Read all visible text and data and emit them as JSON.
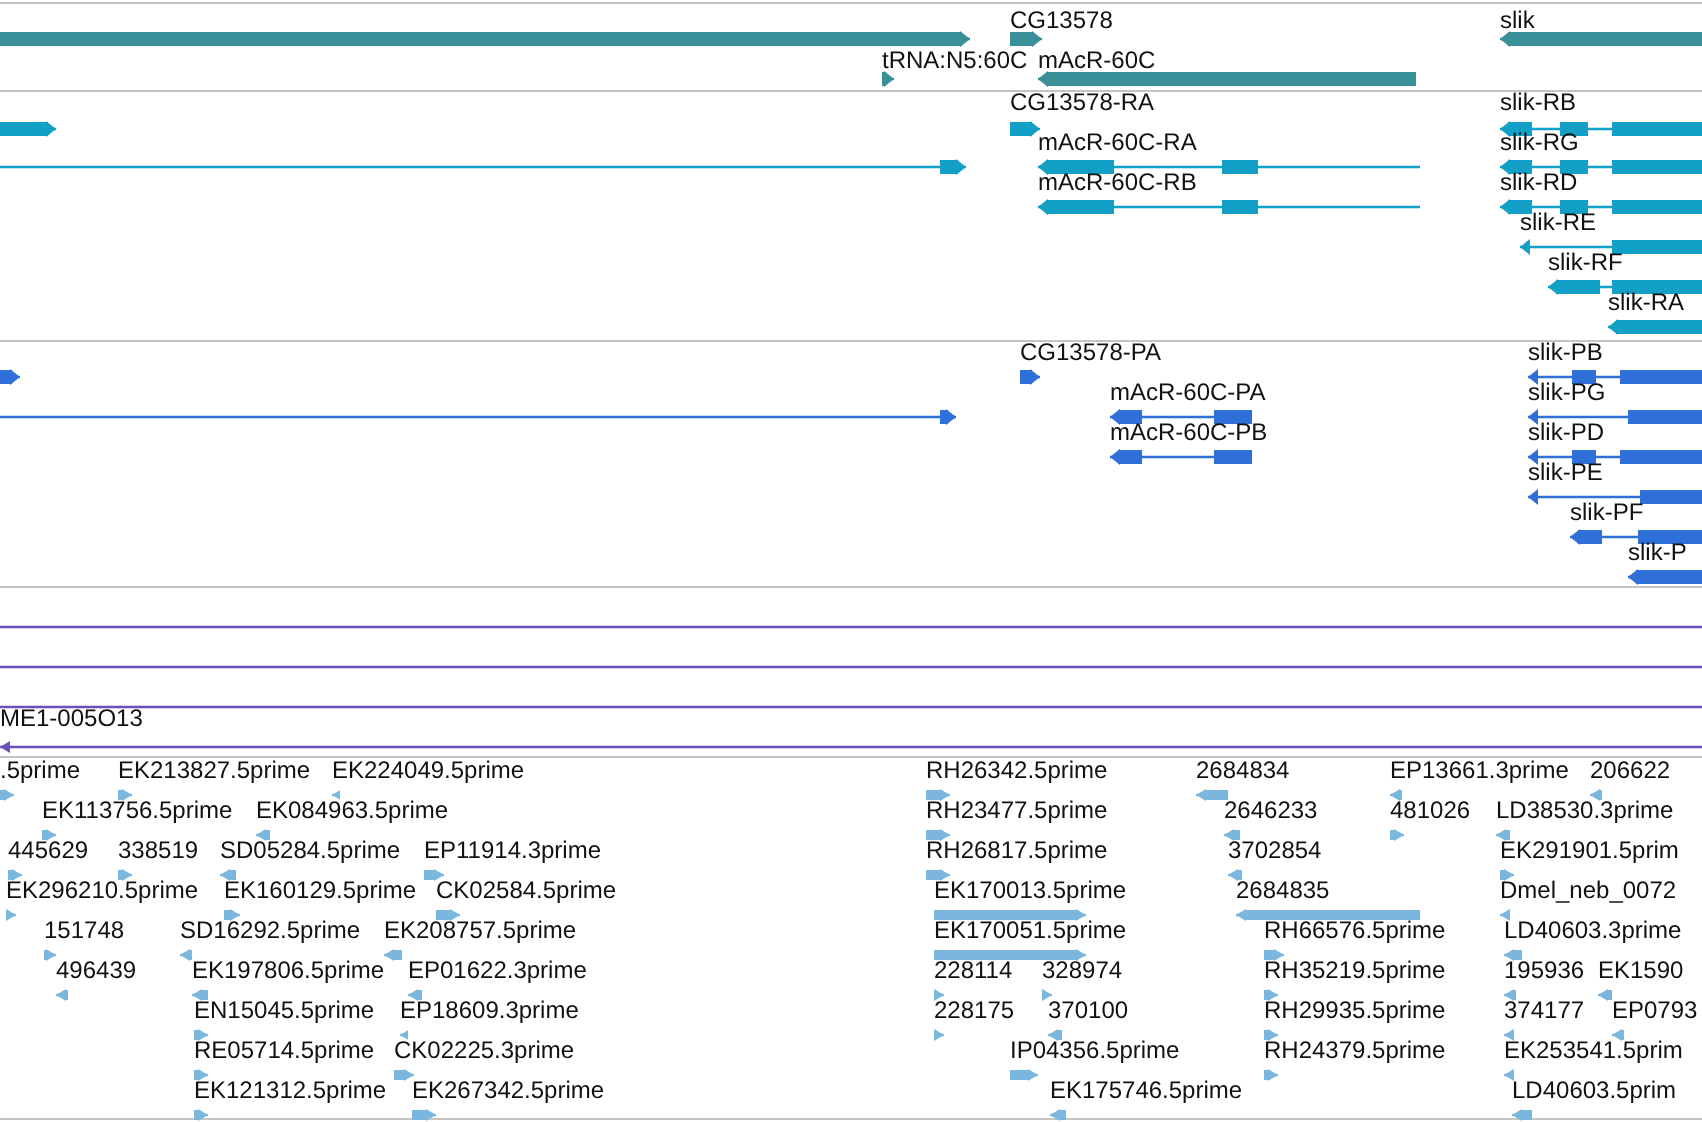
{
  "tracks": [
    {
      "kind": "gene",
      "features": [
        {
          "reverse": false
        },
        {
          "label": "CG13578",
          "reverse": false
        },
        {
          "label": "slik",
          "reverse": true
        },
        {
          "label": "tRNA:N5:60C",
          "reverse": false
        },
        {
          "label": "mAcR-60C",
          "reverse": true
        }
      ]
    },
    {
      "kind": "transcript",
      "features": [
        {
          "reverse": false
        },
        {
          "reverse": false
        },
        {
          "label": "CG13578-RA",
          "reverse": false
        },
        {
          "label": "mAcR-60C-RA",
          "reverse": true
        },
        {
          "label": "mAcR-60C-RB",
          "reverse": true
        },
        {
          "label": "slik-RB",
          "reverse": true
        },
        {
          "label": "slik-RG",
          "reverse": true
        },
        {
          "label": "slik-RD",
          "reverse": true
        },
        {
          "label": "slik-RE",
          "reverse": true
        },
        {
          "label": "slik-RF",
          "reverse": true
        },
        {
          "label": "slik-RA",
          "reverse": true
        }
      ]
    },
    {
      "kind": "protein",
      "features": [
        {
          "reverse": false
        },
        {
          "reverse": false
        },
        {
          "label": "CG13578-PA",
          "reverse": false
        },
        {
          "label": "mAcR-60C-PA",
          "reverse": true
        },
        {
          "label": "mAcR-60C-PB",
          "reverse": true
        },
        {
          "label": "slik-PB",
          "reverse": true
        },
        {
          "label": "slik-PG",
          "reverse": true
        },
        {
          "label": "slik-PD",
          "reverse": true
        },
        {
          "label": "slik-PE",
          "reverse": true
        },
        {
          "label": "slik-PF",
          "reverse": true
        },
        {
          "label": "slik-P",
          "reverse": true
        }
      ]
    },
    {
      "kind": "clone",
      "features": [
        {
          "kind": "span"
        },
        {
          "kind": "span"
        },
        {
          "kind": "span"
        },
        {
          "kind": "clone",
          "label": "ME1-005O13",
          "reverse": true
        }
      ]
    },
    {
      "kind": "est",
      "features": [
        {
          "label": ".5prime",
          "reverse": false
        },
        {
          "label": "EK213827.5prime",
          "reverse": false
        },
        {
          "label": "EK224049.5prime",
          "reverse": true
        },
        {
          "label": "RH26342.5prime",
          "reverse": false
        },
        {
          "label": "2684834",
          "reverse": true
        },
        {
          "label": "EP13661.3prime",
          "reverse": true
        },
        {
          "label": "206622",
          "reverse": true
        },
        {
          "label": "EK113756.5prime",
          "reverse": false
        },
        {
          "label": "EK084963.5prime",
          "reverse": true
        },
        {
          "label": "RH23477.5prime",
          "reverse": false
        },
        {
          "label": "2646233",
          "reverse": true
        },
        {
          "label": "481026",
          "reverse": false
        },
        {
          "label": "LD38530.3prime",
          "reverse": true
        },
        {
          "label": "445629",
          "reverse": false
        },
        {
          "label": "338519",
          "reverse": false
        },
        {
          "label": "SD05284.5prime",
          "reverse": true
        },
        {
          "label": "EP11914.3prime",
          "reverse": false
        },
        {
          "label": "RH26817.5prime",
          "reverse": false
        },
        {
          "label": "3702854",
          "reverse": true
        },
        {
          "label": "EK291901.5prim",
          "reverse": false
        },
        {
          "label": "EK296210.5prime",
          "reverse": false
        },
        {
          "label": "EK160129.5prime",
          "reverse": false
        },
        {
          "label": "CK02584.5prime",
          "reverse": false
        },
        {
          "label": "EK170013.5prime",
          "reverse": false
        },
        {
          "label": "2684835",
          "reverse": true
        },
        {
          "label": "Dmel_neb_0072",
          "reverse": true
        },
        {
          "label": "151748",
          "reverse": false
        },
        {
          "label": "SD16292.5prime",
          "reverse": true
        },
        {
          "label": "EK208757.5prime",
          "reverse": true
        },
        {
          "label": "EK170051.5prime",
          "reverse": false
        },
        {
          "label": "RH66576.5prime",
          "reverse": false
        },
        {
          "label": "LD40603.3prime",
          "reverse": true
        },
        {
          "label": "496439",
          "reverse": true
        },
        {
          "label": "EK197806.5prime",
          "reverse": true
        },
        {
          "label": "EP01622.3prime",
          "reverse": true
        },
        {
          "label": "228114",
          "reverse": false
        },
        {
          "label": "328974",
          "reverse": false
        },
        {
          "label": "RH35219.5prime",
          "reverse": false
        },
        {
          "label": "195936",
          "reverse": true
        },
        {
          "label": "EK1590",
          "reverse": true
        },
        {
          "label": "EN15045.5prime",
          "reverse": false
        },
        {
          "label": "EP18609.3prime",
          "reverse": true
        },
        {
          "label": "228175",
          "reverse": false
        },
        {
          "label": "370100",
          "reverse": true
        },
        {
          "label": "RH29935.5prime",
          "reverse": false
        },
        {
          "label": "374177",
          "reverse": true
        },
        {
          "label": "EP0793",
          "reverse": true
        },
        {
          "label": "RE05714.5prime",
          "reverse": false
        },
        {
          "label": "CK02225.3prime",
          "reverse": false
        },
        {
          "label": "IP04356.5prime",
          "reverse": false
        },
        {
          "label": "RH24379.5prime",
          "reverse": false
        },
        {
          "label": "EK253541.5prim",
          "reverse": true
        },
        {
          "label": "EK121312.5prime",
          "reverse": false
        },
        {
          "label": "EK267342.5prime",
          "reverse": false
        },
        {
          "label": "EK175746.5prime",
          "reverse": true
        },
        {
          "label": "LD40603.5prim",
          "reverse": true
        }
      ]
    }
  ]
}
